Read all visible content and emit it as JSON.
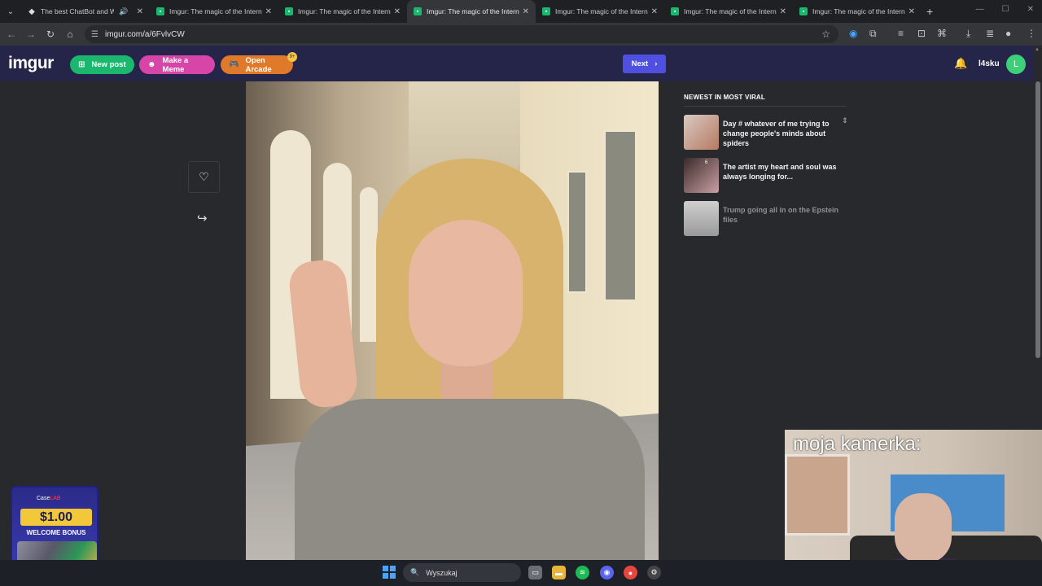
{
  "browser": {
    "tabs": [
      {
        "title": "The best ChatBot and Widg",
        "active": false,
        "audio": true,
        "icon": "gem-icon"
      },
      {
        "title": "Imgur: The magic of the Intern",
        "active": false
      },
      {
        "title": "Imgur: The magic of the Intern",
        "active": false
      },
      {
        "title": "Imgur: The magic of the Intern",
        "active": true
      },
      {
        "title": "Imgur: The magic of the Intern",
        "active": false
      },
      {
        "title": "Imgur: The magic of the Intern",
        "active": false
      },
      {
        "title": "Imgur: The magic of the Intern",
        "active": false
      }
    ],
    "url": "imgur.com/a/6FvlvCW"
  },
  "imgur": {
    "logo": "imgur",
    "new_post": "New post",
    "make_meme": "Make a Meme",
    "open_arcade": "Open Arcade",
    "arcade_badge": "9+",
    "next": "Next",
    "username": "l4sku",
    "avatar_letter": "L"
  },
  "viral": {
    "heading": "NEWEST IN MOST VIRAL",
    "items": [
      {
        "title": "Day # whatever of me trying to change people's minds about spiders",
        "count": ""
      },
      {
        "title": "The artist my heart and soul was always longing for...",
        "count": "6"
      },
      {
        "title": "Trump going all in on the Epstein files",
        "count": ""
      }
    ]
  },
  "ad": {
    "brand": "Case",
    "brand_accent": "LAB",
    "amount": "$1.00",
    "bonus": "WELCOME BONUS"
  },
  "webcam": {
    "label": "moja kamerka:"
  },
  "taskbar": {
    "search": "Wyszukaj"
  },
  "colors": {
    "imgur_bar": "#242549",
    "green": "#1bb76e",
    "pink": "#d745a8",
    "orange": "#e07a2a",
    "next_blue": "#4f4fe1"
  }
}
